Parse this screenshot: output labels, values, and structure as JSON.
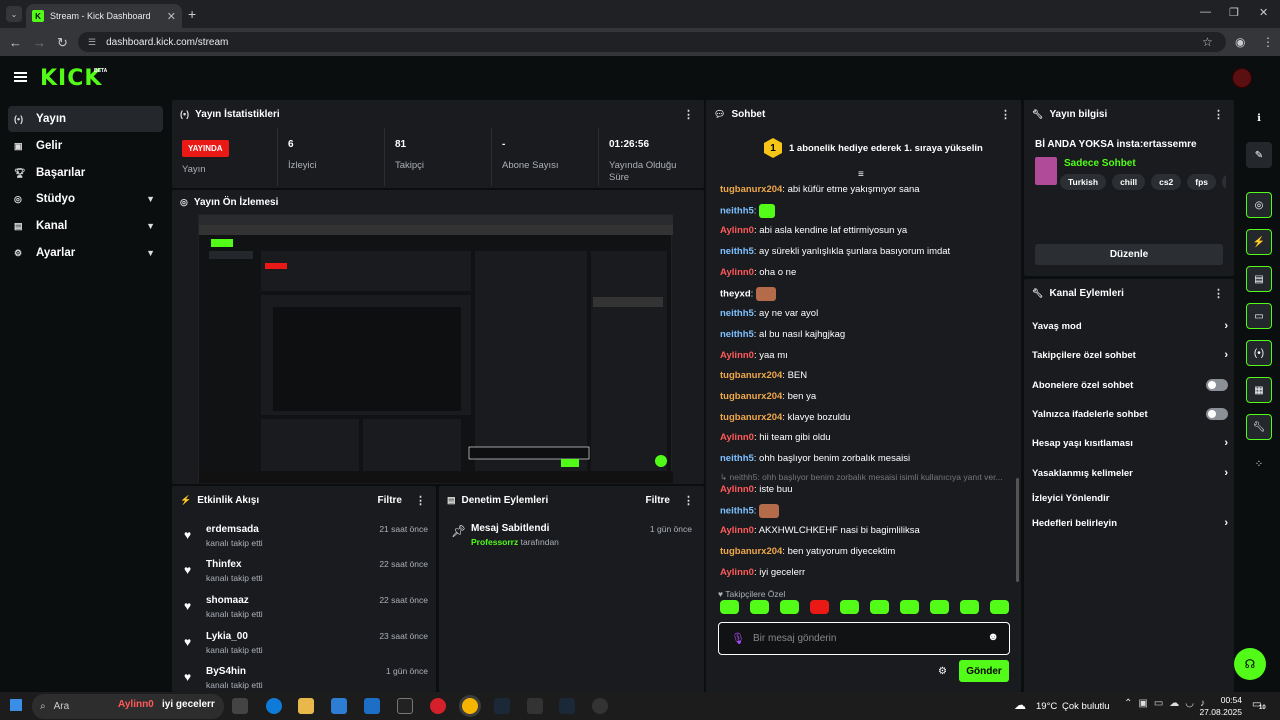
{
  "browser": {
    "tab_title": "Stream - Kick Dashboard",
    "tab_favicon": "K",
    "url": "dashboard.kick.com/stream"
  },
  "header": {
    "logo": "KICK",
    "logo_badge": "BETA"
  },
  "sidebar": {
    "items": [
      {
        "label": "Yayın",
        "icon": "broadcast-icon"
      },
      {
        "label": "Gelir",
        "icon": "income-icon"
      },
      {
        "label": "Başarılar",
        "icon": "trophy-icon"
      },
      {
        "label": "Stüdyo",
        "icon": "studio-icon"
      },
      {
        "label": "Kanal",
        "icon": "channel-icon"
      },
      {
        "label": "Ayarlar",
        "icon": "gear-icon"
      }
    ]
  },
  "stats": {
    "title": "Yayın İstatistikleri",
    "live_badge": "YAYINDA",
    "live_label": "Yayın",
    "viewers_value": "6",
    "viewers_label": "İzleyici",
    "followers_value": "81",
    "followers_label": "Takipçi",
    "subs_value": "-",
    "subs_label": "Abone Sayısı",
    "duration_value": "01:26:56",
    "duration_label": "Yayında Olduğu Süre"
  },
  "preview": {
    "title": "Yayın Ön İzlemesi"
  },
  "activity": {
    "title": "Etkinlik Akışı",
    "filter": "Filtre",
    "events": [
      {
        "name": "erdemsada",
        "sub": "kanalı takip etti",
        "time": "21 saat önce"
      },
      {
        "name": "Thinfex",
        "sub": "kanalı takip etti",
        "time": "22 saat önce"
      },
      {
        "name": "shomaaz",
        "sub": "kanalı takip etti",
        "time": "22 saat önce"
      },
      {
        "name": "Lykia_00",
        "sub": "kanalı takip etti",
        "time": "23 saat önce"
      },
      {
        "name": "ByS4hin",
        "sub": "kanalı takip etti",
        "time": "1 gün önce"
      }
    ]
  },
  "moderation": {
    "title": "Denetim Eylemleri",
    "filter": "Filtre",
    "item_title": "Mesaj Sabitlendi",
    "item_by_user": "Professorrz",
    "item_by_suffix": "tarafından",
    "item_time": "1 gün önce"
  },
  "chat": {
    "title": "Sohbet",
    "gift_rank": "1",
    "gift_text": "1 abonelik hediye ederek 1. sıraya yükselin",
    "messages": [
      {
        "user": "tugbanurx204",
        "color": "orange",
        "text": ": abi küfür etme yakışmıyor sana"
      },
      {
        "user": "neithh5",
        "color": "blue",
        "text": ": ",
        "emote": "green"
      },
      {
        "user": "Aylinn0",
        "color": "red",
        "text": ": abi asla kendine laf ettirmiyosun ya"
      },
      {
        "user": "neithh5",
        "color": "blue",
        "text": ": ay sürekli yanlışlıkla şunlara basıyorum imdat"
      },
      {
        "user": "Aylinn0",
        "color": "red",
        "text": ": oha o ne"
      },
      {
        "user": "theyxd",
        "color": "white",
        "text": ": ",
        "emote": "face"
      },
      {
        "user": "neithh5",
        "color": "blue",
        "text": ": ay ne var ayol"
      },
      {
        "user": "neithh5",
        "color": "blue",
        "text": ": al bu nasıl kajhgjkag"
      },
      {
        "user": "Aylinn0",
        "color": "red",
        "text": ": yaa mı"
      },
      {
        "user": "tugbanurx204",
        "color": "orange",
        "text": ": BEN"
      },
      {
        "user": "tugbanurx204",
        "color": "orange",
        "text": ": ben ya"
      },
      {
        "user": "tugbanurx204",
        "color": "orange",
        "text": ": klavye bozuldu"
      },
      {
        "user": "Aylinn0",
        "color": "red",
        "text": ": hii team gibi oldu"
      },
      {
        "user": "neithh5",
        "color": "blue",
        "text": ": ohh başlıyor benim zorbalık mesaisi"
      }
    ],
    "reply_ref": "neithh5: ohh başlıyor benim zorbalık mesaisi isimli kullanıcıya yanıt ver...",
    "messages2": [
      {
        "user": "Aylinn0",
        "color": "red",
        "text": ": iste buu"
      },
      {
        "user": "neithh5",
        "color": "blue",
        "text": ": ",
        "emote": "face"
      },
      {
        "user": "Aylinn0",
        "color": "red",
        "text": ": AKXHWLCHKEHF nasi bi bagimliliksa"
      },
      {
        "user": "tugbanurx204",
        "color": "orange",
        "text": ": ben yatıyorum diyecektim"
      },
      {
        "user": "Aylinn0",
        "color": "red",
        "text": ": iyi gecelerr"
      }
    ],
    "follower_only_label": "Takipçilere Özel",
    "input_placeholder": "Bir mesaj gönderin",
    "send_label": "Gönder"
  },
  "stream_info": {
    "title": "Yayın bilgisi",
    "stream_title": "Bİ ANDA YOKSA insta:ertassemre",
    "category": "Sadece Sohbet",
    "tags": [
      "Turkish",
      "chill",
      "cs2",
      "fps",
      "gaming"
    ],
    "edit_label": "Düzenle"
  },
  "channel_actions": {
    "title": "Kanal Eylemleri",
    "items": [
      {
        "label": "Yavaş mod",
        "kind": "arrow"
      },
      {
        "label": "Takipçilere özel sohbet",
        "kind": "arrow"
      },
      {
        "label": "Abonelere özel sohbet",
        "kind": "toggle"
      },
      {
        "label": "Yalnızca ifadelerle sohbet",
        "kind": "toggle"
      },
      {
        "label": "Hesap yaşı kısıtlaması",
        "kind": "arrow"
      },
      {
        "label": "Yasaklanmış kelimeler",
        "kind": "arrow"
      },
      {
        "label": "İzleyici Yönlendir",
        "kind": "none"
      },
      {
        "label": "Hedefleri belirleyin",
        "kind": "arrow"
      }
    ]
  },
  "taskbar": {
    "search_placeholder": "Ara",
    "search_highlight_user": "Aylinn0",
    "search_highlight_text": "iyi gecelerr",
    "weather": "19°C",
    "weather_desc": "Çok bulutlu",
    "time": "00:54",
    "date": "27.08.2025",
    "notif_count": "10"
  }
}
